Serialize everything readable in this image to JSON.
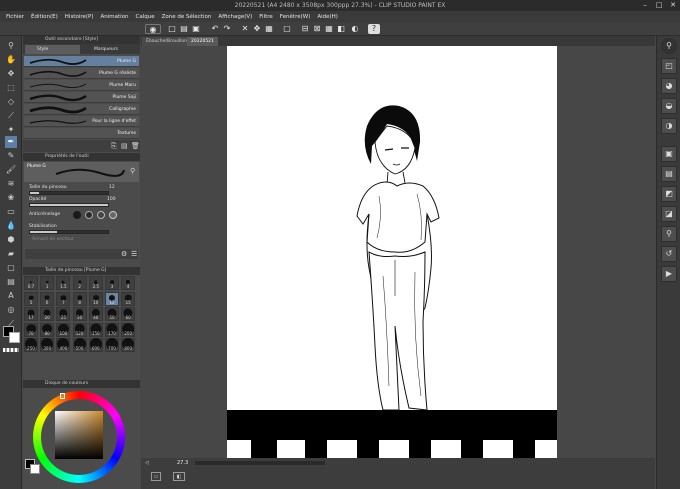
{
  "window": {
    "title": "20220521 (A4 2480 x 3508px 300ppp 27.3%) - CLIP STUDIO PAINT EX"
  },
  "menu": [
    "Fichier",
    "Édition(E)",
    "Histoire(P)",
    "Animation",
    "Calque",
    "Zone de Sélection",
    "Affichage(V)",
    "Filtre",
    "Fenêtre(W)",
    "Aide(H)"
  ],
  "subtool_panel": {
    "title": "Outil secondaire [Style]",
    "tabs": [
      "Style",
      "Marqueurs"
    ]
  },
  "brushes": [
    "Plume G",
    "Plume G réaliste",
    "Plume Maru",
    "Plume Saji",
    "Calligraphie",
    "Pour la ligne d'effet",
    "Textures"
  ],
  "tool_property": {
    "title": "Propriétés de l'outil",
    "brush_name": "Plume G",
    "size_label": "Taille du pinceau",
    "size_value": "12",
    "size_level": 0.12,
    "opacity_label": "Opacité",
    "opacity_value": "100",
    "opacity_level": 1.0,
    "antialias_label": "Anticrénelage",
    "stabilization_label": "Stabilisation",
    "stabilization_level": 0.35,
    "vector_label": "Aimant de vecteur"
  },
  "brush_size_panel": {
    "title": "Taille de pinceau [Plume G]",
    "sizes": [
      "0.7",
      "1",
      "1.5",
      "2",
      "2.5",
      "3",
      "4",
      "5",
      "6",
      "7",
      "8",
      "10",
      "12",
      "15",
      "17",
      "20",
      "25",
      "30",
      "40",
      "50",
      "60",
      "70",
      "80",
      "100",
      "120",
      "150",
      "170",
      "200",
      "250",
      "300",
      "400",
      "500",
      "600",
      "700",
      "800"
    ],
    "selected": "12"
  },
  "color_panel": {
    "title": "Disque de couleurs",
    "main": "#000000",
    "sub": "#ffffff",
    "accent": "#c98a2e"
  },
  "doc_tabs": [
    "Ébauche(Brouillon)",
    "20220521"
  ],
  "zoom": "27.3",
  "icons": {
    "cmd": [
      "new-icon",
      "open-icon",
      "save-icon",
      "undo-icon",
      "redo-icon",
      "clear-icon",
      "transform-icon",
      "fill-icon",
      "snap-icon",
      "ruler-icon",
      "grid-icon",
      "cps-icon"
    ],
    "tools": [
      "zoom-icon",
      "hand-icon",
      "move-icon",
      "select-icon",
      "lasso-icon",
      "eyedropper-icon",
      "pen-icon",
      "pencil-icon",
      "brush-icon",
      "airbrush-icon",
      "blend-icon",
      "eraser-icon",
      "fill-icon",
      "gradient-icon",
      "frame-icon",
      "text-icon",
      "balloon-icon",
      "line-icon",
      "ruler-icon",
      "correct-line-icon",
      "figure-icon"
    ]
  }
}
